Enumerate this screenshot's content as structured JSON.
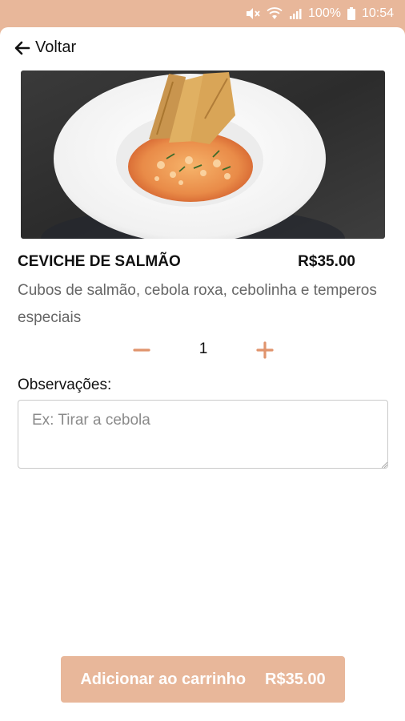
{
  "status_bar": {
    "battery_percent": "100%",
    "time": "10:54",
    "icons": [
      "mute-icon",
      "wifi-icon",
      "signal-icon",
      "battery-icon"
    ]
  },
  "nav": {
    "back_label": "Voltar",
    "back_icon": "arrow-left-icon"
  },
  "product": {
    "image_icon": "dish-photo",
    "name": "CEVICHE DE SALMÃO",
    "price": "R$35.00",
    "description": "Cubos de salmão, cebola roxa, cebolinha e temperos especiais"
  },
  "quantity": {
    "value": "1",
    "decrease_icon": "minus-icon",
    "increase_icon": "plus-icon"
  },
  "notes": {
    "label": "Observações:",
    "placeholder": "Ex: Tirar a cebola",
    "value": ""
  },
  "cart_button": {
    "label": "Adicionar ao carrinho",
    "price": "R$35.00"
  },
  "colors": {
    "accent": "#e8b79a",
    "qty_icon": "#e0946d",
    "text_dark": "#111111",
    "text_muted": "#666666"
  }
}
